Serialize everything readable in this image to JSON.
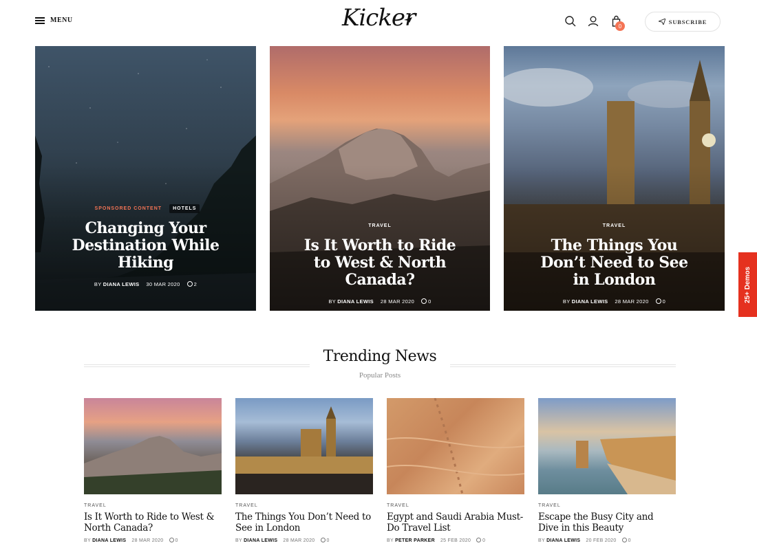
{
  "header": {
    "menu_label": "MENU",
    "logo_text": "Kicker",
    "cart_count": "0",
    "subscribe_label": "SUBSCRIBE",
    "icons": [
      "menu-icon",
      "search-icon",
      "user-icon",
      "cart-icon",
      "paper-plane-icon"
    ]
  },
  "hero": [
    {
      "categories": [
        "SPONSORED CONTENT",
        "HOTELS"
      ],
      "title": "Changing Your Destination While Hiking",
      "by": "BY",
      "author": "DIANA LEWIS",
      "date": "30 MAR 2020",
      "comments": "2"
    },
    {
      "categories": [
        "TRAVEL"
      ],
      "title": "Is It Worth to Ride to West & North Canada?",
      "by": "BY",
      "author": "DIANA LEWIS",
      "date": "28 MAR 2020",
      "comments": "0"
    },
    {
      "categories": [
        "TRAVEL"
      ],
      "title": "The Things You Don’t Need to See in London",
      "by": "BY",
      "author": "DIANA LEWIS",
      "date": "28 MAR 2020",
      "comments": "0"
    }
  ],
  "side_tab": "25+ Demos",
  "trending": {
    "title": "Trending News",
    "subtitle": "Popular Posts",
    "posts": [
      {
        "category": "TRAVEL",
        "title": "Is It Worth to Ride to West & North Canada?",
        "by": "BY",
        "author": "DIANA LEWIS",
        "date": "28 MAR 2020",
        "comments": "0"
      },
      {
        "category": "TRAVEL",
        "title": "The Things You Don’t Need to See in London",
        "by": "BY",
        "author": "DIANA LEWIS",
        "date": "28 MAR 2020",
        "comments": "0"
      },
      {
        "category": "TRAVEL",
        "title": "Egypt and Saudi Arabia Must-Do Travel List",
        "by": "BY",
        "author": "PETER PARKER",
        "date": "25 FEB 2020",
        "comments": "0"
      },
      {
        "category": "TRAVEL",
        "title": "Escape the Busy City and Dive in this Beauty",
        "by": "BY",
        "author": "DIANA LEWIS",
        "date": "20 FEB 2020",
        "comments": "0"
      }
    ]
  },
  "colors": {
    "accent": "#f47455",
    "side_tab": "#e5311f",
    "text": "#111111"
  }
}
